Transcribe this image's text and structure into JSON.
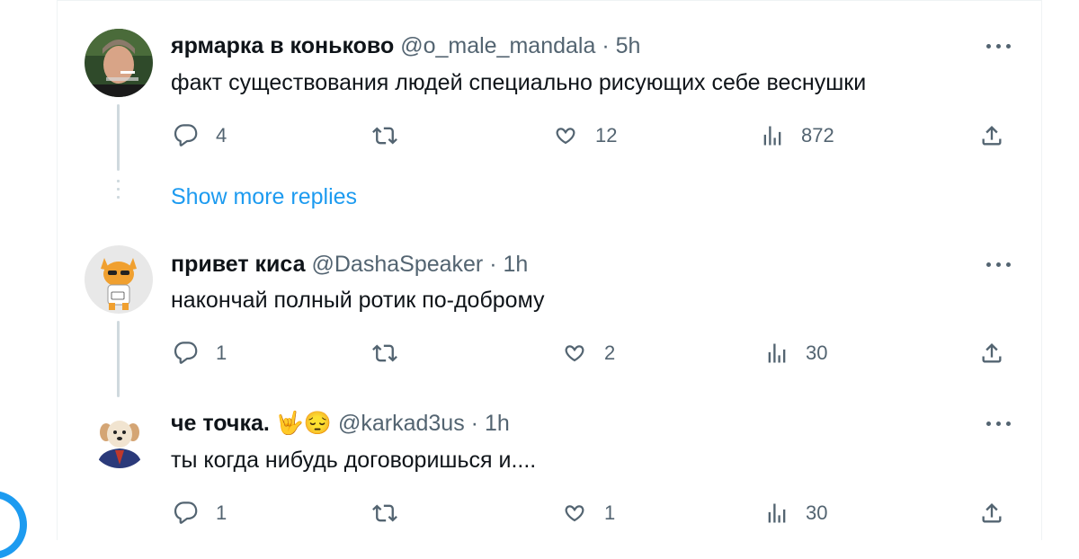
{
  "thread": {
    "show_more_label": "Show more replies",
    "tweets": [
      {
        "name": "ярмарка в коньково",
        "name_emoji": "",
        "handle": "@o_male_mandala",
        "time": "5h",
        "text": "факт существования людей специально рисующих себе веснушки",
        "replies": "4",
        "retweets": "",
        "likes": "12",
        "views": "872"
      },
      {
        "name": "привет киса",
        "name_emoji": "",
        "handle": "@DashaSpeaker",
        "time": "1h",
        "text": "накончай полный ротик по-доброму",
        "replies": "1",
        "retweets": "",
        "likes": "2",
        "views": "30"
      },
      {
        "name": "че точка.",
        "name_emoji": "🤟😔",
        "handle": "@karkad3us",
        "time": "1h",
        "text": "ты когда нибудь договоришься и....",
        "replies": "1",
        "retweets": "",
        "likes": "1",
        "views": "30"
      }
    ]
  },
  "separator": "·",
  "icons": {
    "reply": "reply-icon",
    "retweet": "retweet-icon",
    "like": "heart-icon",
    "views": "views-icon",
    "share": "share-icon",
    "more": "more-icon"
  },
  "colors": {
    "accent": "#1d9bf0",
    "muted": "#536471",
    "text": "#0f1419",
    "border": "#eff3f4"
  }
}
